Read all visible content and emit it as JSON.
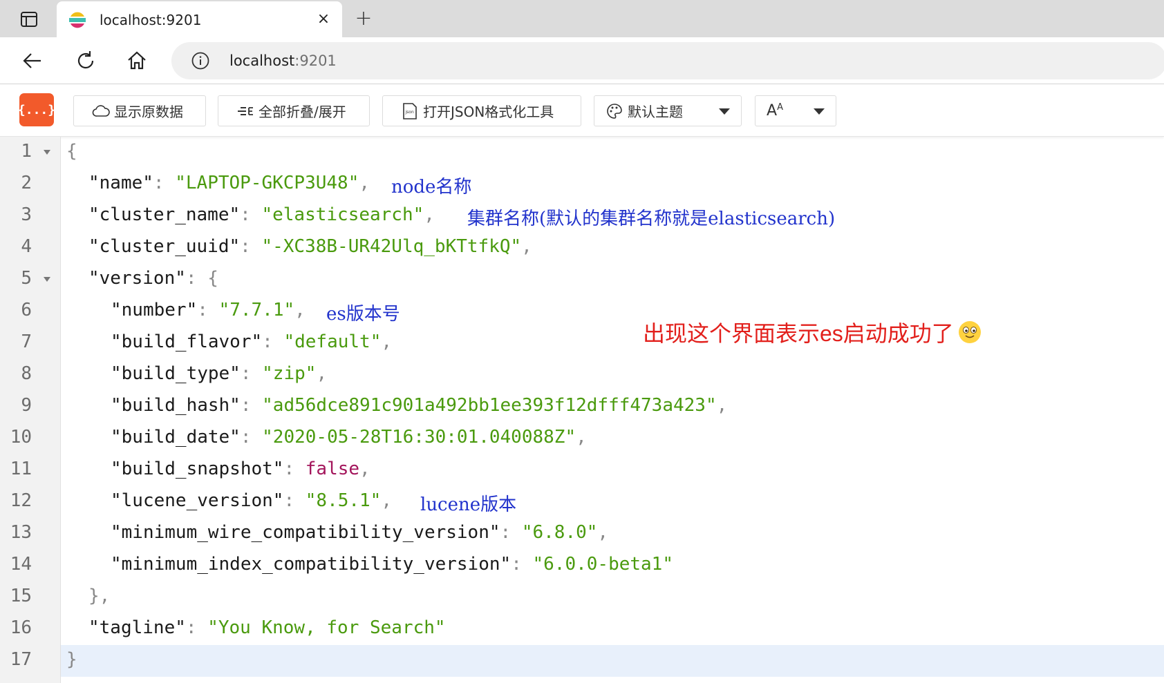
{
  "browser": {
    "tab_title": "localhost:9201",
    "url_host": "localhost",
    "url_port": ":9201",
    "close_glyph": "×",
    "new_tab_glyph": "+"
  },
  "toolbar": {
    "logo_text": "{...}",
    "raw_data_label": "显示原数据",
    "fold_label": "全部折叠/展开",
    "open_tool_label": "打开JSON格式化工具",
    "theme_label": "默认主题",
    "font_label": "A"
  },
  "colors": {
    "accent": "#f25a2b",
    "string": "#4a9a0e",
    "boolean": "#a3155b",
    "annotation": "#2233cc",
    "banner": "#e2201c"
  },
  "code_lines": [
    {
      "n": "1",
      "text": "{"
    },
    {
      "n": "2",
      "key": "\"name\"",
      "val": "\"LAPTOP-GKCP3U48\"",
      "note": "node名称"
    },
    {
      "n": "3",
      "key": "\"cluster_name\"",
      "val": "\"elasticsearch\"",
      "note": "集群名称(默认的集群名称就是elasticsearch)"
    },
    {
      "n": "4",
      "key": "\"cluster_uuid\"",
      "val": "\"-XC38B-UR42Ulq_bKTtfkQ\""
    },
    {
      "n": "5",
      "key": "\"version\"",
      "text": "{"
    },
    {
      "n": "6",
      "key": "\"number\"",
      "val": "\"7.7.1\"",
      "note": "es版本号"
    },
    {
      "n": "7",
      "key": "\"build_flavor\"",
      "val": "\"default\""
    },
    {
      "n": "8",
      "key": "\"build_type\"",
      "val": "\"zip\""
    },
    {
      "n": "9",
      "key": "\"build_hash\"",
      "val": "\"ad56dce891c901a492bb1ee393f12dfff473a423\""
    },
    {
      "n": "10",
      "key": "\"build_date\"",
      "val": "\"2020-05-28T16:30:01.040088Z\""
    },
    {
      "n": "11",
      "key": "\"build_snapshot\"",
      "val": "false"
    },
    {
      "n": "12",
      "key": "\"lucene_version\"",
      "val": "\"8.5.1\"",
      "note": "lucene版本"
    },
    {
      "n": "13",
      "key": "\"minimum_wire_compatibility_version\"",
      "val": "\"6.8.0\""
    },
    {
      "n": "14",
      "key": "\"minimum_index_compatibility_version\"",
      "val": "\"6.0.0-beta1\""
    },
    {
      "n": "15",
      "text": "},"
    },
    {
      "n": "16",
      "key": "\"tagline\"",
      "val": "\"You Know, for Search\""
    },
    {
      "n": "17",
      "text": "}"
    }
  ],
  "banner_text": "出现这个界面表示es启动成功了"
}
